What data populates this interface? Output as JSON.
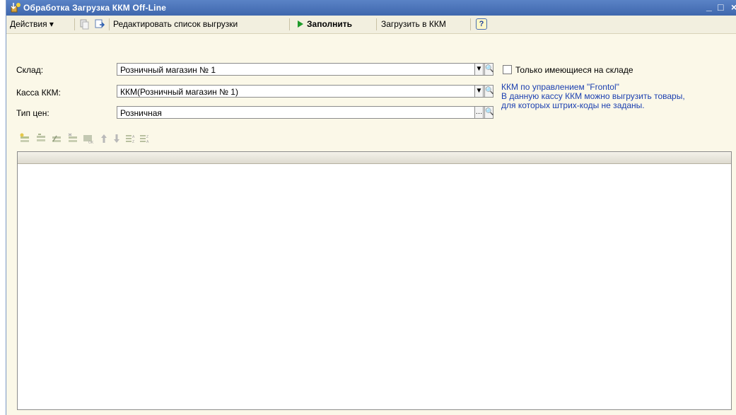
{
  "window": {
    "title": "Обработка  Загрузка ККМ Off-Line",
    "minimize": "_",
    "maximize": "□",
    "close": "×"
  },
  "toolbar": {
    "actions": "Действия ▾",
    "edit_list": "Редактировать список выгрузки",
    "fill": "Заполнить",
    "load": "Загрузить в ККМ",
    "help": "?"
  },
  "form": {
    "warehouse": {
      "label": "Склад:",
      "value": "Розничный магазин № 1"
    },
    "kkm": {
      "label": "Касса ККМ:",
      "value": "ККМ(Розничный магазин № 1)"
    },
    "price_type": {
      "label": "Тип цен:",
      "value": "Розничная"
    },
    "only_in_stock": {
      "label": "Только имеющиеся на складе",
      "checked": false
    }
  },
  "note": {
    "line1": "ККМ по управлением \"Frontol\"",
    "line2": "В данную кассу ККМ можно выгрузить товары,",
    "line3": "для которых штрих-коды не заданы."
  },
  "colors": {
    "title_bar": "#4a72b8",
    "form_bg": "#fbf8e8",
    "note_text": "#1b3fb0",
    "fill_arrow": "#1e9a2a"
  }
}
